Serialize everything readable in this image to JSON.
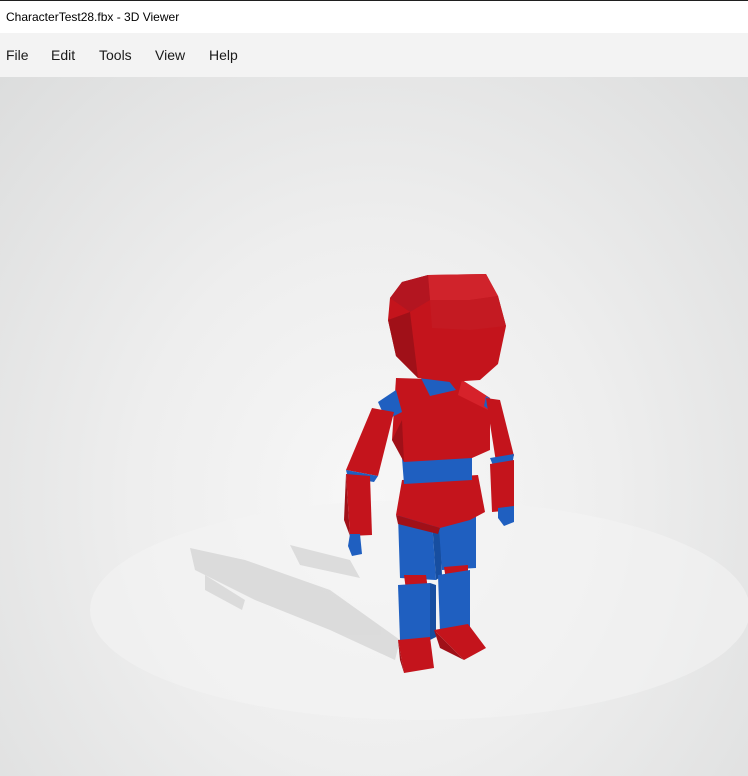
{
  "window": {
    "title": "CharacterTest28.fbx - 3D Viewer"
  },
  "menu": {
    "file": "File",
    "edit": "Edit",
    "tools": "Tools",
    "view": "View",
    "help": "Help"
  },
  "viewport": {
    "model_colors": {
      "primary": "#c4141c",
      "secondary": "#1f5fc0"
    }
  }
}
